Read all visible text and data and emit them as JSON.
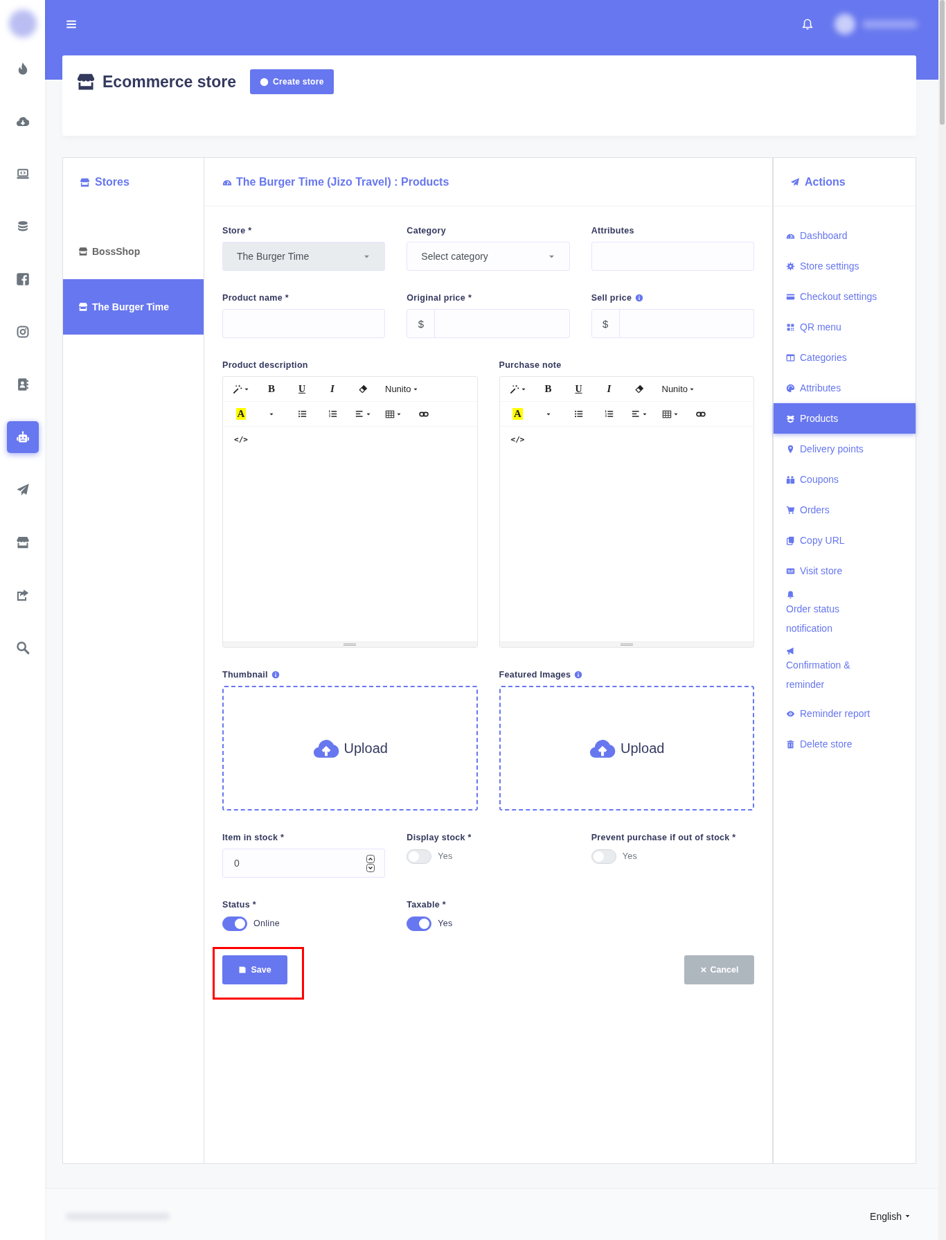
{
  "sidebar": {
    "items": [
      {
        "kind": "flame",
        "selected": false
      },
      {
        "kind": "cloud-download",
        "selected": false
      },
      {
        "kind": "laptop-code",
        "selected": false
      },
      {
        "kind": "coins",
        "selected": false
      },
      {
        "kind": "facebook",
        "selected": false
      },
      {
        "kind": "camera",
        "selected": false
      },
      {
        "kind": "contact-book",
        "selected": false
      },
      {
        "kind": "robot",
        "selected": true
      },
      {
        "kind": "paper-plane",
        "selected": false
      },
      {
        "kind": "store",
        "selected": false
      },
      {
        "kind": "share",
        "selected": false
      },
      {
        "kind": "search",
        "selected": false
      }
    ]
  },
  "header": {
    "title": "Ecommerce store",
    "button": "Create store"
  },
  "stores": {
    "title": "Stores",
    "items": [
      {
        "label": "BossShop",
        "selected": false
      },
      {
        "label": "The Burger Time",
        "selected": true
      }
    ]
  },
  "form": {
    "title": "The Burger Time (Jizo Travel) : Products",
    "rows": [
      [
        {
          "kind": "select",
          "label": "Store *",
          "value": "The Burger Time",
          "disabled": true
        },
        {
          "kind": "select",
          "label": "Category",
          "placeholder": "Select category",
          "disabled": false
        },
        {
          "kind": "input",
          "label": "Attributes"
        }
      ],
      [
        {
          "kind": "input",
          "label": "Product name *"
        },
        {
          "kind": "prefixed",
          "label": "Original price *",
          "prefix": "$"
        },
        {
          "kind": "prefixed",
          "label": "Sell price",
          "info": true,
          "prefix": "$"
        }
      ]
    ],
    "editors": [
      {
        "label": "Product description",
        "toolbar": [
          [
            {
              "kind": "style"
            },
            {
              "kind": "bold",
              "text": "B"
            },
            {
              "kind": "underline",
              "text": "U"
            },
            {
              "kind": "italic",
              "text": "I"
            },
            {
              "kind": "eraser"
            },
            {
              "kind": "font",
              "text": "Nunito"
            }
          ],
          [
            {
              "kind": "color",
              "text": "A"
            },
            {
              "kind": "color-menu"
            },
            {
              "kind": "bullets"
            },
            {
              "kind": "numbers"
            },
            {
              "kind": "align"
            },
            {
              "kind": "table"
            },
            {
              "kind": "link"
            }
          ],
          [
            {
              "kind": "code",
              "text": "</>"
            }
          ]
        ]
      },
      {
        "label": "Purchase note",
        "toolbar": [
          [
            {
              "kind": "style"
            },
            {
              "kind": "bold",
              "text": "B"
            },
            {
              "kind": "underline",
              "text": "U"
            },
            {
              "kind": "italic",
              "text": "I"
            },
            {
              "kind": "eraser"
            },
            {
              "kind": "font",
              "text": "Nunito"
            }
          ],
          [
            {
              "kind": "color",
              "text": "A"
            },
            {
              "kind": "color-menu"
            },
            {
              "kind": "bullets"
            },
            {
              "kind": "numbers"
            },
            {
              "kind": "align"
            },
            {
              "kind": "table"
            },
            {
              "kind": "link"
            }
          ],
          [
            {
              "kind": "code",
              "text": "</>"
            }
          ]
        ]
      }
    ],
    "uploads": [
      {
        "label": "Thumbnail",
        "info": true,
        "text": "Upload"
      },
      {
        "label": "Featured Images",
        "info": true,
        "text": "Upload"
      }
    ],
    "stock": {
      "label": "Item in stock *",
      "value": "0"
    },
    "toggles": [
      {
        "label": "Display stock *",
        "on": false,
        "text": "Yes"
      },
      {
        "label": "Prevent purchase if out of stock *",
        "on": false,
        "text": "Yes"
      },
      {
        "label": "Status *",
        "on": true,
        "text": "Online"
      },
      {
        "label": "Taxable *",
        "on": true,
        "text": "Yes"
      }
    ],
    "save": {
      "label": "Save",
      "highlighted": true
    },
    "cancel": {
      "label": "Cancel",
      "disabled": true
    }
  },
  "actions": {
    "title": "Actions",
    "items": [
      {
        "kind": "gauge",
        "label": "Dashboard",
        "selected": false
      },
      {
        "kind": "gear",
        "label": "Store settings",
        "selected": false
      },
      {
        "kind": "card",
        "label": "Checkout settings",
        "selected": false
      },
      {
        "kind": "qr",
        "label": "QR menu",
        "selected": false
      },
      {
        "kind": "columns",
        "label": "Categories",
        "selected": false
      },
      {
        "kind": "palette",
        "label": "Attributes",
        "selected": false
      },
      {
        "kind": "boxes",
        "label": "Products",
        "selected": true
      },
      {
        "kind": "pin",
        "label": "Delivery points",
        "selected": false
      },
      {
        "kind": "tags",
        "label": "Coupons",
        "selected": false
      },
      {
        "kind": "cart",
        "label": "Orders",
        "selected": false
      },
      {
        "kind": "copy",
        "label": "Copy URL",
        "selected": false
      },
      {
        "kind": "idcard",
        "label": "Visit store",
        "selected": false
      },
      {
        "kind": "bell",
        "label": "Order status notification",
        "selected": false
      },
      {
        "kind": "bullhorn",
        "label": "Confirmation & reminder",
        "selected": false
      },
      {
        "kind": "eye",
        "label": "Reminder report",
        "selected": false
      },
      {
        "kind": "trash",
        "label": "Delete store",
        "selected": false
      }
    ]
  },
  "footer": {
    "language": "English"
  }
}
